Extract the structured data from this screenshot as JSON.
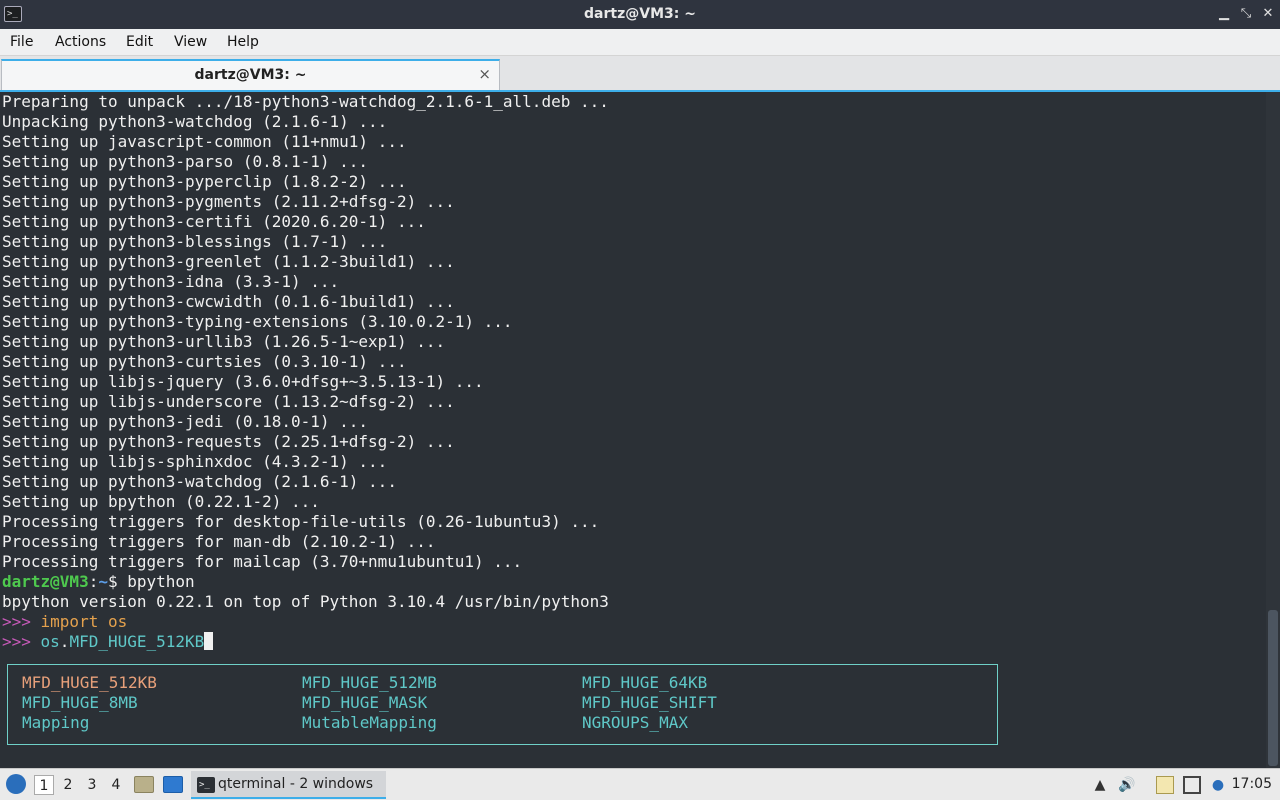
{
  "window": {
    "title": "dartz@VM3: ~",
    "app_icon": "terminal-icon",
    "controls": [
      "minimize-icon",
      "restore-icon",
      "close-icon"
    ]
  },
  "menu": {
    "items": [
      "File",
      "Actions",
      "Edit",
      "View",
      "Help"
    ]
  },
  "tab": {
    "label": "dartz@VM3: ~",
    "close_glyph": "×"
  },
  "terminal": {
    "output_lines": [
      "Preparing to unpack .../18-python3-watchdog_2.1.6-1_all.deb ...",
      "Unpacking python3-watchdog (2.1.6-1) ...",
      "Setting up javascript-common (11+nmu1) ...",
      "Setting up python3-parso (0.8.1-1) ...",
      "Setting up python3-pyperclip (1.8.2-2) ...",
      "Setting up python3-pygments (2.11.2+dfsg-2) ...",
      "Setting up python3-certifi (2020.6.20-1) ...",
      "Setting up python3-blessings (1.7-1) ...",
      "Setting up python3-greenlet (1.1.2-3build1) ...",
      "Setting up python3-idna (3.3-1) ...",
      "Setting up python3-cwcwidth (0.1.6-1build1) ...",
      "Setting up python3-typing-extensions (3.10.0.2-1) ...",
      "Setting up python3-urllib3 (1.26.5-1~exp1) ...",
      "Setting up python3-curtsies (0.3.10-1) ...",
      "Setting up libjs-jquery (3.6.0+dfsg+~3.5.13-1) ...",
      "Setting up libjs-underscore (1.13.2~dfsg-2) ...",
      "Setting up python3-jedi (0.18.0-1) ...",
      "Setting up python3-requests (2.25.1+dfsg-2) ...",
      "Setting up libjs-sphinxdoc (4.3.2-1) ...",
      "Setting up python3-watchdog (2.1.6-1) ...",
      "Setting up bpython (0.22.1-2) ...",
      "Processing triggers for desktop-file-utils (0.26-1ubuntu3) ...",
      "Processing triggers for man-db (2.10.2-1) ...",
      "Processing triggers for mailcap (3.70+nmu1ubuntu1) ..."
    ],
    "prompt": {
      "user_host": "dartz@VM3",
      "sep": ":",
      "path": "~",
      "symbol": "$ ",
      "command": "bpython"
    },
    "bpython_banner": "bpython version 0.22.1 on top of Python 3.10.4 /usr/bin/python3",
    "repl": {
      "prompt": ">>> ",
      "line1_keyword": "import",
      "line1_rest": " os",
      "line2_module": "os",
      "line2_dot": ".",
      "line2_attr": "MFD_HUGE_512KB"
    },
    "completions": [
      [
        "MFD_HUGE_512KB",
        "MFD_HUGE_512MB",
        "MFD_HUGE_64KB"
      ],
      [
        "MFD_HUGE_8MB",
        "MFD_HUGE_MASK",
        "MFD_HUGE_SHIFT"
      ],
      [
        "Mapping",
        "MutableMapping",
        "NGROUPS_MAX"
      ]
    ],
    "selected_completion": "MFD_HUGE_512KB"
  },
  "taskbar": {
    "start_icon": "lubuntu-logo-icon",
    "workspaces": [
      "1",
      "2",
      "3",
      "4"
    ],
    "active_workspace": "1",
    "quicklaunch": [
      "file-manager-icon",
      "show-desktop-icon"
    ],
    "task_label": "qterminal - 2 windows",
    "tray_icons": [
      "update-notifier-icon",
      "volume-icon",
      "clipboard-icon",
      "network-icon",
      "notification-icon"
    ],
    "clock": "17:05"
  },
  "colors": {
    "accent": "#3daee9",
    "terminal_bg": "#2b3036",
    "prompt_user": "#4ec94e",
    "prompt_path": "#5c9ee8",
    "completion": "#5fc8c8",
    "completion_selected": "#e8a07a"
  }
}
